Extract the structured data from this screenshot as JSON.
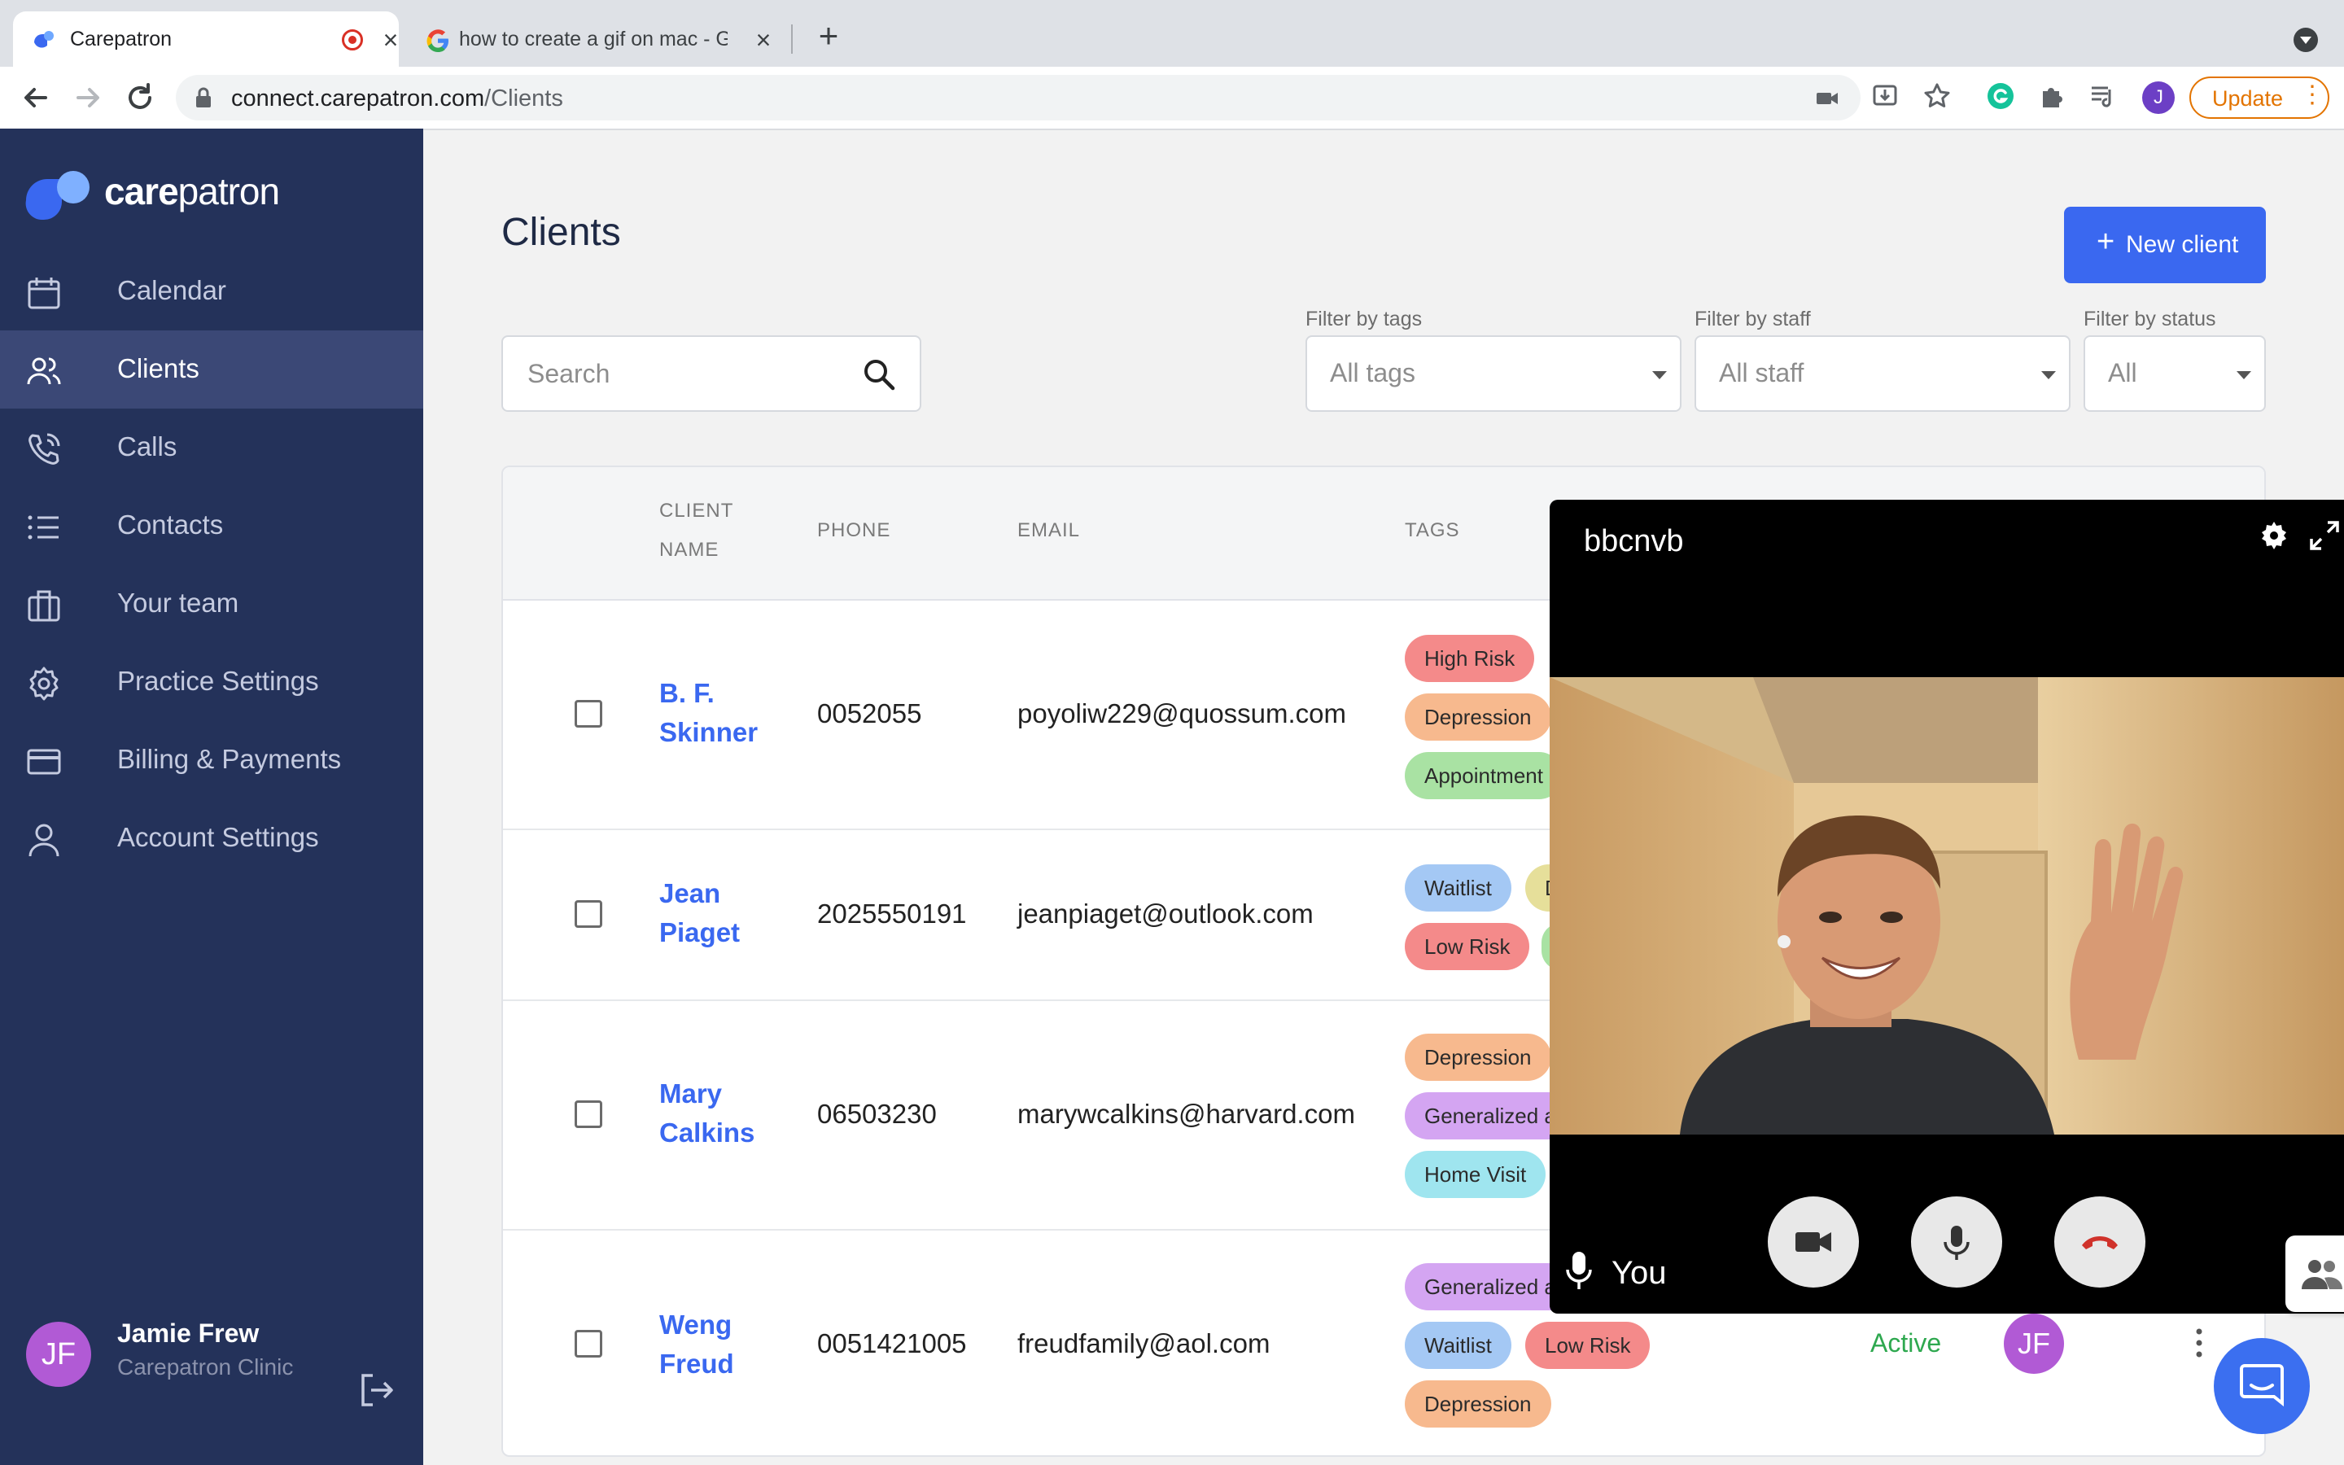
{
  "browser": {
    "tabs": [
      {
        "title": "Carepatron",
        "active": true
      },
      {
        "title": "how to create a gif on mac - Go",
        "active": false
      }
    ],
    "url_host": "connect.carepatron.com",
    "url_path": "/Clients",
    "profile_initial": "J",
    "update_label": "Update"
  },
  "sidebar": {
    "brand_bold": "care",
    "brand_rest": "patron",
    "items": [
      {
        "label": "Calendar",
        "icon": "calendar-icon"
      },
      {
        "label": "Clients",
        "icon": "people-icon",
        "active": true
      },
      {
        "label": "Calls",
        "icon": "phone-icon"
      },
      {
        "label": "Contacts",
        "icon": "list-icon"
      },
      {
        "label": "Your team",
        "icon": "briefcase-icon"
      },
      {
        "label": "Practice Settings",
        "icon": "gear-icon"
      },
      {
        "label": "Billing & Payments",
        "icon": "credit-card-icon"
      },
      {
        "label": "Account Settings",
        "icon": "person-icon"
      }
    ],
    "user": {
      "initials": "JF",
      "name": "Jamie Frew",
      "clinic": "Carepatron Clinic"
    }
  },
  "main": {
    "title": "Clients",
    "new_client_label": "New client",
    "search_placeholder": "Search",
    "filters": [
      {
        "label": "Filter by tags",
        "value": "All tags"
      },
      {
        "label": "Filter by staff",
        "value": "All staff"
      },
      {
        "label": "Filter by status",
        "value": "All"
      }
    ],
    "columns": [
      "CLIENT NAME",
      "PHONE",
      "EMAIL",
      "TAGS"
    ],
    "rows": [
      {
        "name": "B. F. Skinner",
        "phone": "0052055",
        "email": "poyoliw229@quossum.com",
        "tags": [
          "High Risk",
          "Depression",
          "Appointment"
        ]
      },
      {
        "name": "Jean Piaget",
        "phone": "2025550191",
        "email": "jeanpiaget@outlook.com",
        "tags": [
          "Waitlist",
          "D",
          "Low Risk",
          ""
        ]
      },
      {
        "name": "Mary Calkins",
        "phone": "06503230",
        "email": "marywcalkins@harvard.com",
        "tags": [
          "Depression",
          "Generalized a",
          "Home Visit"
        ]
      },
      {
        "name": "Weng Freud",
        "phone": "0051421005",
        "email": "freudfamily@aol.com",
        "tags": [
          "Generalized a",
          "Waitlist",
          "Low Risk",
          "Depression"
        ],
        "status": "Active",
        "staff_initials": "JF"
      }
    ]
  },
  "video_call": {
    "title": "bbcnvb",
    "self_label": "You"
  }
}
